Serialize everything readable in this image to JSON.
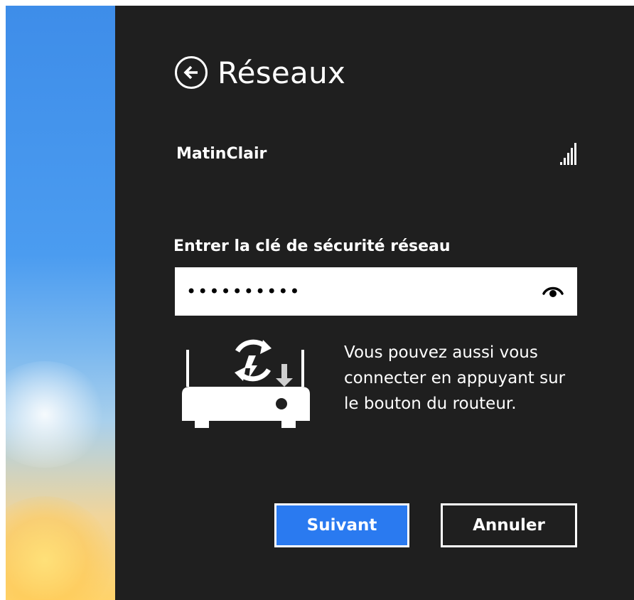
{
  "header": {
    "title": "Réseaux",
    "back_icon": "arrow-left-circle-icon"
  },
  "network": {
    "name": "MatinClair",
    "signal_icon": "signal-strength-icon",
    "signal_bars": 5
  },
  "security": {
    "label": "Entrer la clé de sécurité réseau",
    "value": "••••••••••",
    "reveal_icon": "eye-icon"
  },
  "wps": {
    "icon": "router-wps-icon",
    "text": "Vous pouvez aussi vous connecter en appuyant sur le bouton du routeur."
  },
  "actions": {
    "next_label": "Suivant",
    "cancel_label": "Annuler"
  },
  "colors": {
    "panel_background": "#1f1f1f",
    "accent": "#2a7af0",
    "text": "#ffffff"
  }
}
